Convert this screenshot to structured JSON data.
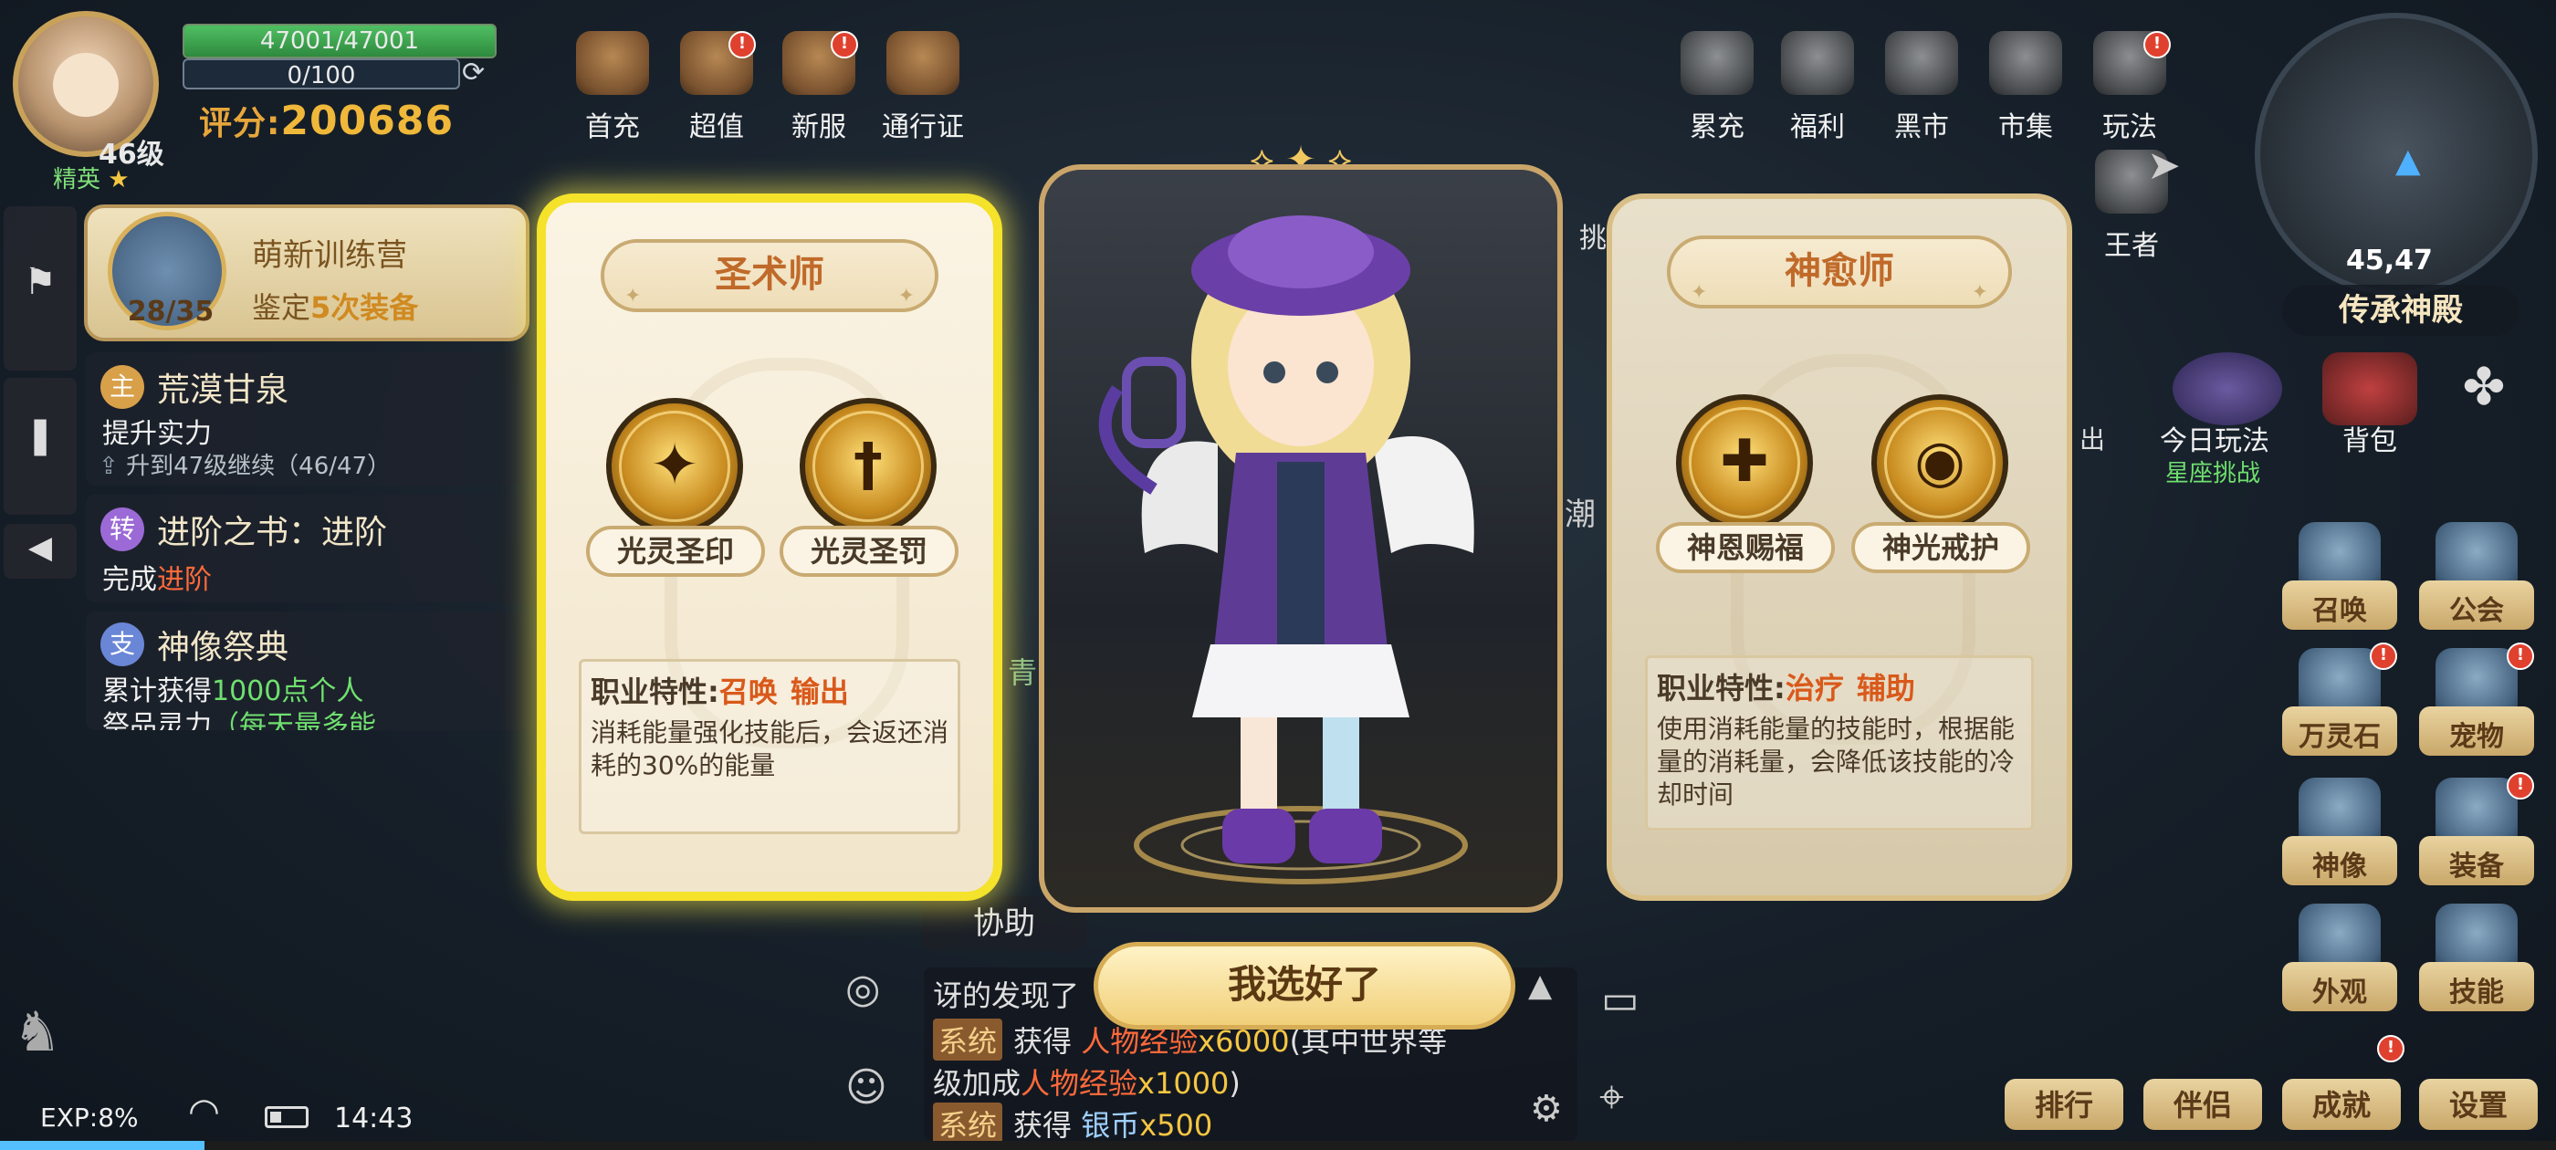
{
  "player": {
    "hp": "47001/47001",
    "mp": "0/100",
    "level": "46级",
    "rank": "精英",
    "score_label": "评分:",
    "score": "200686"
  },
  "quests": {
    "camp_title": "萌新训练营",
    "camp_task_prefix": "鉴定",
    "camp_task_highlight": "5次装备",
    "camp_progress": "28/35",
    "items": [
      {
        "badge": "主",
        "badge_color": "#d9a04a",
        "title": "荒漠甘泉",
        "text": "提升实力",
        "sub": "升到47级继续（46/47）"
      },
      {
        "badge": "转",
        "badge_color": "#9b6ad6",
        "title": "进阶之书：进阶",
        "text_prefix": "完成",
        "text_highlight": "进阶"
      },
      {
        "badge": "支",
        "badge_color": "#6a86d6",
        "title": "神像祭典",
        "text_prefix": "累计获得",
        "text_highlight": "1000点个人",
        "text2_prefix": "祭品灵力",
        "text2_highlight": "（每天最多能"
      }
    ]
  },
  "top_icons_left": [
    {
      "name": "first-charge",
      "label": "首充"
    },
    {
      "name": "super-value",
      "label": "超值",
      "badge": "!"
    },
    {
      "name": "new-server",
      "label": "新服",
      "badge": "!"
    },
    {
      "name": "pass",
      "label": "通行证"
    }
  ],
  "top_icons_right": [
    {
      "name": "cumulative-charge",
      "label": "累充"
    },
    {
      "name": "welfare",
      "label": "福利"
    },
    {
      "name": "black-market",
      "label": "黑市"
    },
    {
      "name": "market",
      "label": "市集"
    },
    {
      "name": "gameplay",
      "label": "玩法",
      "badge": "!"
    }
  ],
  "second_row_labels": [
    "挑",
    "王者",
    "潮",
    "出",
    "青"
  ],
  "map": {
    "coord": "45,47",
    "name": "传承神殿"
  },
  "right_panel": {
    "daily": "今日玩法",
    "daily_sub": "星座挑战",
    "bag": "背包"
  },
  "right_icons": [
    {
      "name": "summon",
      "label": "召唤"
    },
    {
      "name": "guild",
      "label": "公会"
    },
    {
      "name": "spirit-stone",
      "label": "万灵石",
      "badge": "!"
    },
    {
      "name": "pet",
      "label": "宠物",
      "badge": "!"
    },
    {
      "name": "statue",
      "label": "神像"
    },
    {
      "name": "equipment",
      "label": "装备",
      "badge": "!"
    },
    {
      "name": "appearance",
      "label": "外观"
    },
    {
      "name": "skill",
      "label": "技能"
    }
  ],
  "bottom_icons": [
    {
      "name": "ranking",
      "label": "排行"
    },
    {
      "name": "partner",
      "label": "伴侣"
    },
    {
      "name": "achievement",
      "label": "成就",
      "badge": "!"
    },
    {
      "name": "settings",
      "label": "设置"
    }
  ],
  "status": {
    "exp": "EXP:8%",
    "time": "14:43",
    "exp_fraction": 0.08
  },
  "chat": {
    "line1": "讶的发现了",
    "tag": "系统",
    "line2_prefix": "获得",
    "line2_item": "人物经验",
    "line2_amount": "x6000",
    "line2_suffix": "(其中世界等",
    "line3_prefix": "级加成",
    "line3_item": "人物经验",
    "line3_amount": "x1000",
    "line3_suffix": ")",
    "line4_prefix": "获得",
    "line4_item": "银币",
    "line4_amount": "x500"
  },
  "assist_label": "协助",
  "side_label": "青",
  "cards": [
    {
      "title": "圣术师",
      "selected": true,
      "skills": [
        {
          "label": "光灵圣印",
          "glyph": "✦"
        },
        {
          "label": "光灵圣罚",
          "glyph": "†"
        }
      ],
      "trait_label": "职业特性:",
      "roles": [
        "召唤",
        "输出"
      ],
      "desc": "消耗能量强化技能后，会返还消耗的30%的能量"
    },
    {
      "title": "神愈师",
      "selected": false,
      "skills": [
        {
          "label": "神恩赐福",
          "glyph": "✚"
        },
        {
          "label": "神光戒护",
          "glyph": "◉"
        }
      ],
      "trait_label": "职业特性:",
      "roles": [
        "治疗",
        "辅助"
      ],
      "desc": "使用消耗能量的技能时，根据能量的消耗量，会降低该技能的冷却时间"
    }
  ],
  "confirm_label": "我选好了"
}
